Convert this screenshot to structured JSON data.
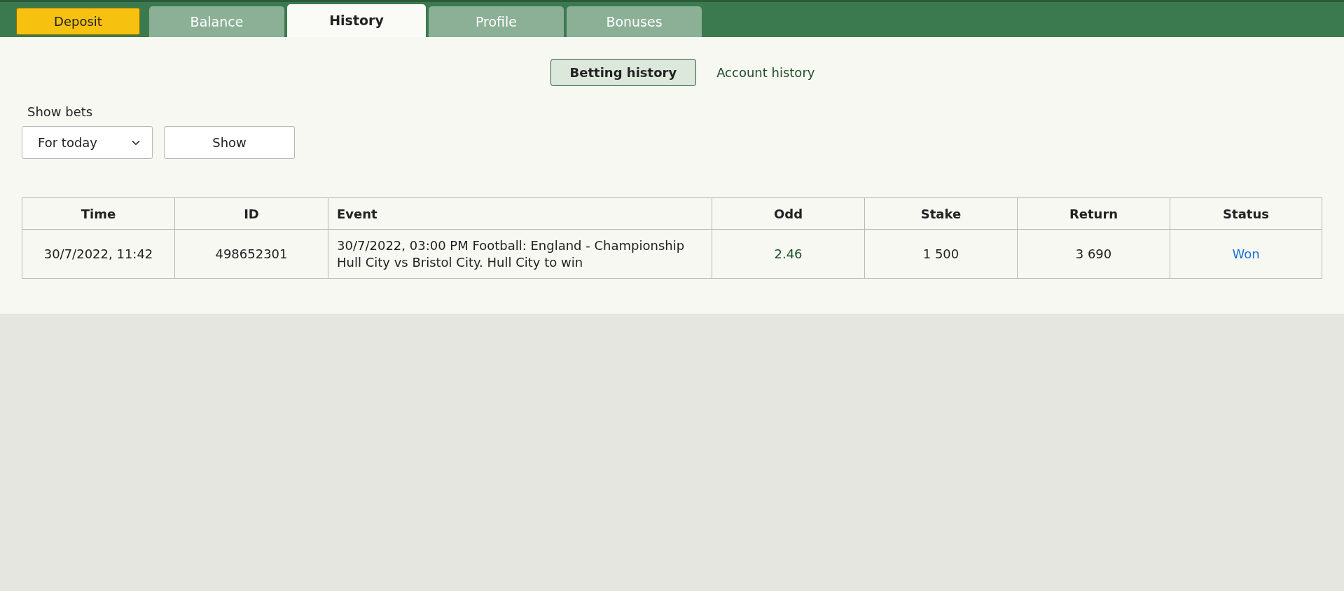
{
  "deposit_button": "Deposit",
  "tabs": [
    {
      "label": "Balance",
      "selected": false
    },
    {
      "label": "History",
      "selected": true
    },
    {
      "label": "Profile",
      "selected": false
    },
    {
      "label": "Bonuses",
      "selected": false
    }
  ],
  "history_tabs": [
    {
      "label": "Betting history",
      "selected": true
    },
    {
      "label": "Account history",
      "selected": false
    }
  ],
  "filter": {
    "label": "Show bets",
    "select_value": "For today",
    "button": "Show"
  },
  "table": {
    "columns": [
      "Time",
      "ID",
      "Event",
      "Odd",
      "Stake",
      "Return",
      "Status"
    ],
    "rows": [
      {
        "time": "30/7/2022, 11:42",
        "id": "498652301",
        "event": [
          "30/7/2022, 03:00 PM Football: England - Championship",
          "Hull City vs Bristol City. Hull City to win"
        ],
        "odd": "2.46",
        "stake": "1 500",
        "return": "3 690",
        "status": "Won"
      }
    ]
  }
}
